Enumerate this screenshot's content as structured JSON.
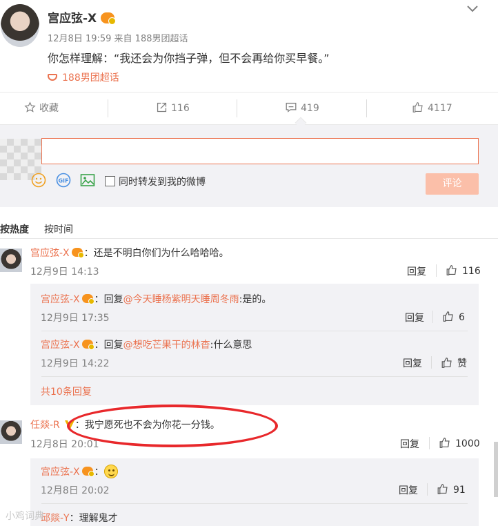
{
  "post": {
    "author": "宫应弦-X",
    "meta": "12月8日 19:59 来自 188男团超话",
    "text": "你怎样理解：“我还会为你挡子弹，但不会再给你买早餐。”",
    "topic": "188男团超话"
  },
  "actions": {
    "favorite": "收藏",
    "repost": "116",
    "comment": "419",
    "like": "4117"
  },
  "compose": {
    "input_value": "",
    "forward_label": "同时转发到我的微博",
    "submit_label": "评论"
  },
  "sort": {
    "hot": "按热度",
    "time": "按时间"
  },
  "comments": [
    {
      "name": "宫应弦-X",
      "text": "：还是不明白你们为什么哈哈哈。",
      "time": "12月9日 14:13",
      "reply": "回复",
      "likes": "116",
      "replies": [
        {
          "name": "宫应弦-X",
          "prefix": "：回复",
          "at": "@今天睡杨紫明天睡周冬雨",
          "text": ":是的。",
          "time": "12月9日 17:35",
          "reply": "回复",
          "likes": "6"
        },
        {
          "name": "宫应弦-X",
          "prefix": "：回复",
          "at": "@想吃芒果干的林杳",
          "text": ":什么意思",
          "time": "12月9日 14:22",
          "reply": "回复",
          "likes": "赞"
        }
      ],
      "more": "共10条回复"
    },
    {
      "name": "任燚-R",
      "text": "：我宁愿死也不会为你花一分钱。",
      "time": "12月8日 20:01",
      "reply": "回复",
      "likes": "1000",
      "replies": [
        {
          "name": "宫应弦-X",
          "prefix": "：",
          "time": "12月8日 20:02",
          "reply": "回复",
          "likes": "91"
        },
        {
          "name": "邱燚-Y",
          "text": "：理解鬼才"
        }
      ]
    }
  ],
  "watermark": "小鸡词典",
  "colors": {
    "accent": "#eb7350",
    "annotation": "#e8282b",
    "panel": "#f2f2f5"
  }
}
